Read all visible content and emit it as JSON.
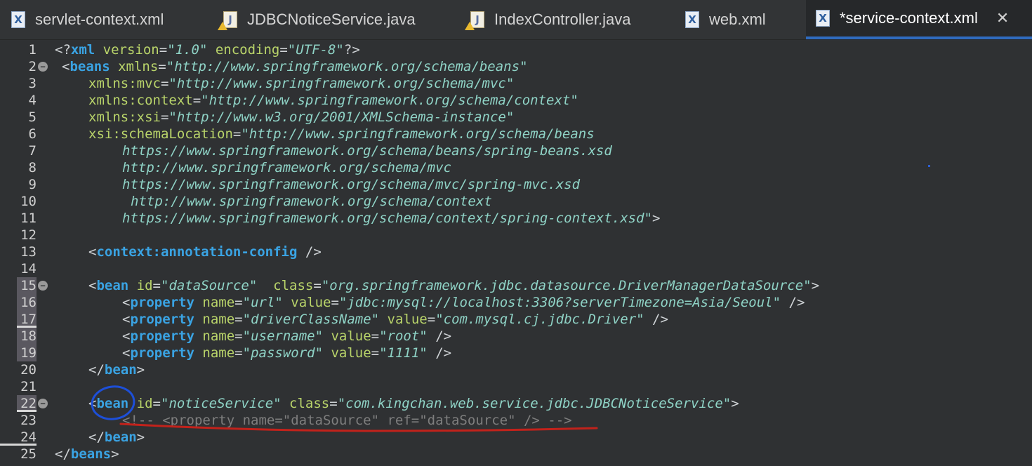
{
  "tabs": [
    {
      "label": "servlet-context.xml",
      "icon": "xml-file-icon"
    },
    {
      "label": "JDBCNoticeService.java",
      "icon": "java-file-warning-icon"
    },
    {
      "label": "IndexController.java",
      "icon": "java-file-warning-icon"
    },
    {
      "label": "web.xml",
      "icon": "xml-file-icon"
    },
    {
      "label": "*service-context.xml",
      "icon": "xml-file-icon",
      "active": true
    }
  ],
  "close_glyph": "✕",
  "fold_glyph": "−",
  "icon_letters": {
    "xml": "X",
    "java": "J"
  },
  "line_numbers": [
    "1",
    "2",
    "3",
    "4",
    "5",
    "6",
    "7",
    "8",
    "9",
    "10",
    "11",
    "12",
    "13",
    "14",
    "15",
    "16",
    "17",
    "18",
    "19",
    "20",
    "21",
    "22",
    "23",
    "24",
    "25"
  ],
  "code": {
    "l1": {
      "open": "<?",
      "tag": "xml",
      "a1": " version",
      "eq1": "=",
      "v1": "\"1.0\"",
      "a2": " encoding",
      "eq2": "=",
      "v2": "\"UTF-8\"",
      "close": "?>"
    },
    "l2": {
      "open": "<",
      "tag": "beans",
      "a1": " xmlns",
      "eq1": "=",
      "v1": "\"http://www.springframework.org/schema/beans\""
    },
    "l3": {
      "a": "xmlns:mvc",
      "eq": "=",
      "v": "\"http://www.springframework.org/schema/mvc\""
    },
    "l4": {
      "a": "xmlns:context",
      "eq": "=",
      "v": "\"http://www.springframework.org/schema/context\""
    },
    "l5": {
      "a": "xmlns:xsi",
      "eq": "=",
      "v": "\"http://www.w3.org/2001/XMLSchema-instance\""
    },
    "l6": {
      "a": "xsi:schemaLocation",
      "eq": "=",
      "v": "\"http://www.springframework.org/schema/beans"
    },
    "l7": {
      "v": "https://www.springframework.org/schema/beans/spring-beans.xsd"
    },
    "l8": {
      "v": "http://www.springframework.org/schema/mvc"
    },
    "l9": {
      "v": "https://www.springframework.org/schema/mvc/spring-mvc.xsd"
    },
    "l10": {
      "v": "http://www.springframework.org/schema/context"
    },
    "l11": {
      "v": "https://www.springframework.org/schema/context/spring-context.xsd\"",
      "close": ">"
    },
    "l13": {
      "open": "<",
      "tag": "context:annotation-config",
      "close": " />"
    },
    "l15": {
      "open": "<",
      "tag": "bean",
      "a1": " id",
      "eq1": "=",
      "v1": "\"dataSource\"",
      "a2": "  class",
      "eq2": "=",
      "v2": "\"org.springframework.jdbc.datasource.DriverManagerDataSource\"",
      "close": ">"
    },
    "l16": {
      "open": "<",
      "tag": "property",
      "a1": " name",
      "eq1": "=",
      "v1": "\"url\"",
      "a2": " value",
      "eq2": "=",
      "v2": "\"jdbc:mysql://localhost:3306?serverTimezone=Asia/Seoul\"",
      "close": " />"
    },
    "l17": {
      "open": "<",
      "tag": "property",
      "a1": " name",
      "eq1": "=",
      "v1": "\"driverClassName\"",
      "a2": " value",
      "eq2": "=",
      "v2": "\"com.mysql.cj.jdbc.Driver\"",
      "close": " />"
    },
    "l18": {
      "open": "<",
      "tag": "property",
      "a1": " name",
      "eq1": "=",
      "v1": "\"username\"",
      "a2": " value",
      "eq2": "=",
      "v2": "\"root\"",
      "close": " />"
    },
    "l19": {
      "open": "<",
      "tag": "property",
      "a1": " name",
      "eq1": "=",
      "v1": "\"password\"",
      "a2": " value",
      "eq2": "=",
      "v2": "\"1111\"",
      "close": " />"
    },
    "l20": {
      "open": "</",
      "tag": "bean",
      "close": ">"
    },
    "l22": {
      "open": "<",
      "tag": "bean",
      "a1": " id",
      "eq1": "=",
      "v1": "\"noticeService\"",
      "a2": " class",
      "eq2": "=",
      "v2": "\"com.kingchan.web.service.jdbc.JDBCNoticeService\"",
      "close": ">"
    },
    "l23": {
      "comment": "<!-- <property name=\"dataSource\" ref=\"dataSource\" /> -->"
    },
    "l24": {
      "open": "</",
      "tag": "bean",
      "close": ">"
    },
    "l25": {
      "open": "</",
      "tag": "beans",
      "close": ">"
    }
  }
}
